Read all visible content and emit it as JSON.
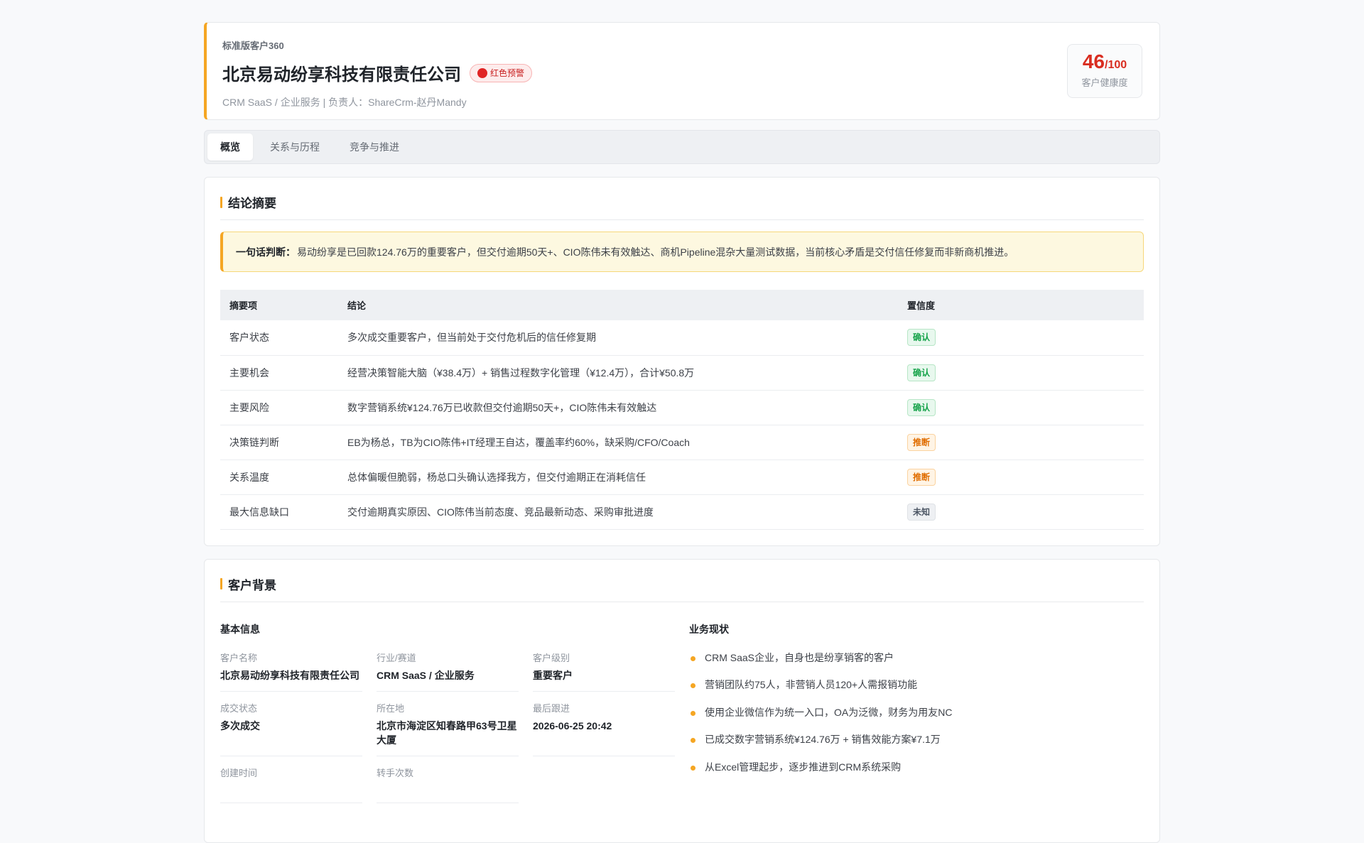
{
  "header": {
    "eyebrow": "标准版客户360",
    "company": "北京易动纷享科技有限责任公司",
    "alert": "红色预警",
    "meta": "CRM SaaS / 企业服务 | 负责人：ShareCrm-赵丹Mandy",
    "score": "46",
    "score_max": "/100",
    "score_label": "客户健康度"
  },
  "tabs": [
    "概览",
    "关系与历程",
    "竞争与推进"
  ],
  "summary": {
    "title": "结论摘要",
    "verdict_label": "一句话判断：",
    "verdict_text": "易动纷享是已回款124.76万的重要客户，但交付逾期50天+、CIO陈伟未有效触达、商机Pipeline混杂大量测试数据，当前核心矛盾是交付信任修复而非新商机推进。",
    "headers": [
      "摘要项",
      "结论",
      "置信度"
    ],
    "rows": [
      {
        "item": "客户状态",
        "conclusion": "多次成交重要客户，但当前处于交付危机后的信任修复期",
        "confidence": "确认"
      },
      {
        "item": "主要机会",
        "conclusion": "经营决策智能大脑（¥38.4万）+ 销售过程数字化管理（¥12.4万），合计¥50.8万",
        "confidence": "确认"
      },
      {
        "item": "主要风险",
        "conclusion": "数字营销系统¥124.76万已收款但交付逾期50天+，CIO陈伟未有效触达",
        "confidence": "确认"
      },
      {
        "item": "决策链判断",
        "conclusion": "EB为杨总，TB为CIO陈伟+IT经理王自达，覆盖率约60%，缺采购/CFO/Coach",
        "confidence": "推断"
      },
      {
        "item": "关系温度",
        "conclusion": "总体偏暖但脆弱，杨总口头确认选择我方，但交付逾期正在消耗信任",
        "confidence": "推断"
      },
      {
        "item": "最大信息缺口",
        "conclusion": "交付逾期真实原因、CIO陈伟当前态度、竞品最新动态、采购审批进度",
        "confidence": "未知"
      }
    ]
  },
  "background": {
    "title": "客户背景",
    "basic_title": "基本信息",
    "fields": [
      {
        "label": "客户名称",
        "value": "北京易动纷享科技有限责任公司"
      },
      {
        "label": "行业/赛道",
        "value": "CRM SaaS / 企业服务"
      },
      {
        "label": "客户级别",
        "value": "重要客户"
      },
      {
        "label": "成交状态",
        "value": "多次成交"
      },
      {
        "label": "所在地",
        "value": "北京市海淀区知春路甲63号卫星大厦"
      },
      {
        "label": "最后跟进",
        "value": "2026-06-25 20:42"
      },
      {
        "label": "创建时间",
        "value": ""
      },
      {
        "label": "转手次数",
        "value": ""
      }
    ],
    "business_title": "业务现状",
    "bullets": [
      "CRM SaaS企业，自身也是纷享销客的客户",
      "营销团队约75人，非营销人员120+人需报销功能",
      "使用企业微信作为统一入口，OA为泛微，财务为用友NC",
      "已成交数字营销系统¥124.76万 + 销售效能方案¥7.1万",
      "从Excel管理起步，逐步推进到CRM系统采购"
    ]
  },
  "colors": {
    "accent": "#f5a623",
    "danger": "#d92d20",
    "confirm": "#16a34a",
    "infer": "#e06d00"
  }
}
